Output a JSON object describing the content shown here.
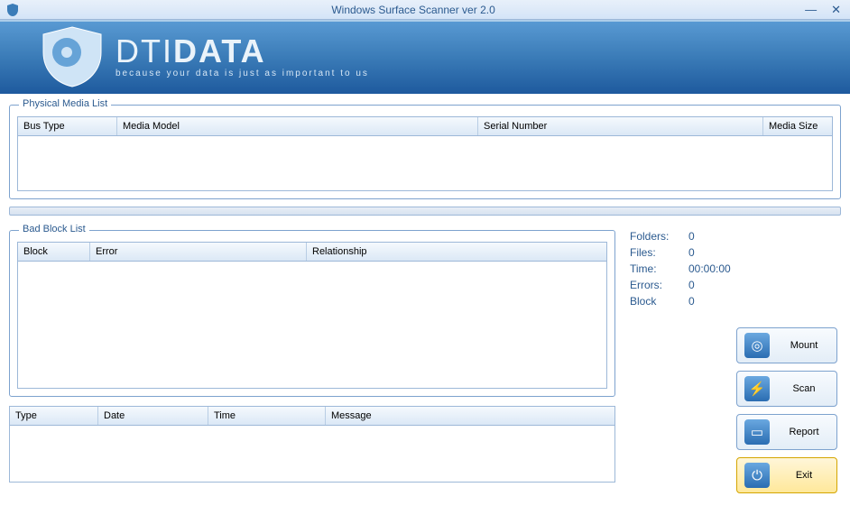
{
  "window": {
    "title": "Windows Surface Scanner ver 2.0"
  },
  "brand": {
    "name_prefix": "DTI",
    "name_suffix": "DATA",
    "tagline": "because your data is just as important to us"
  },
  "physical_media": {
    "title": "Physical Media List",
    "columns": {
      "bus": "Bus Type",
      "model": "Media Model",
      "serial": "Serial Number",
      "size": "Media Size"
    }
  },
  "bad_block": {
    "title": "Bad Block List",
    "columns": {
      "block": "Block",
      "error": "Error",
      "relationship": "Relationship"
    }
  },
  "log": {
    "columns": {
      "type": "Type",
      "date": "Date",
      "time": "Time",
      "message": "Message"
    }
  },
  "stats": {
    "folders_label": "Folders:",
    "folders_value": "0",
    "files_label": "Files:",
    "files_value": "0",
    "time_label": "Time:",
    "time_value": "00:00:00",
    "errors_label": "Errors:",
    "errors_value": "0",
    "block_label": "Block",
    "block_value": "0"
  },
  "buttons": {
    "mount": "Mount",
    "scan": "Scan",
    "report": "Report",
    "exit": "Exit"
  }
}
